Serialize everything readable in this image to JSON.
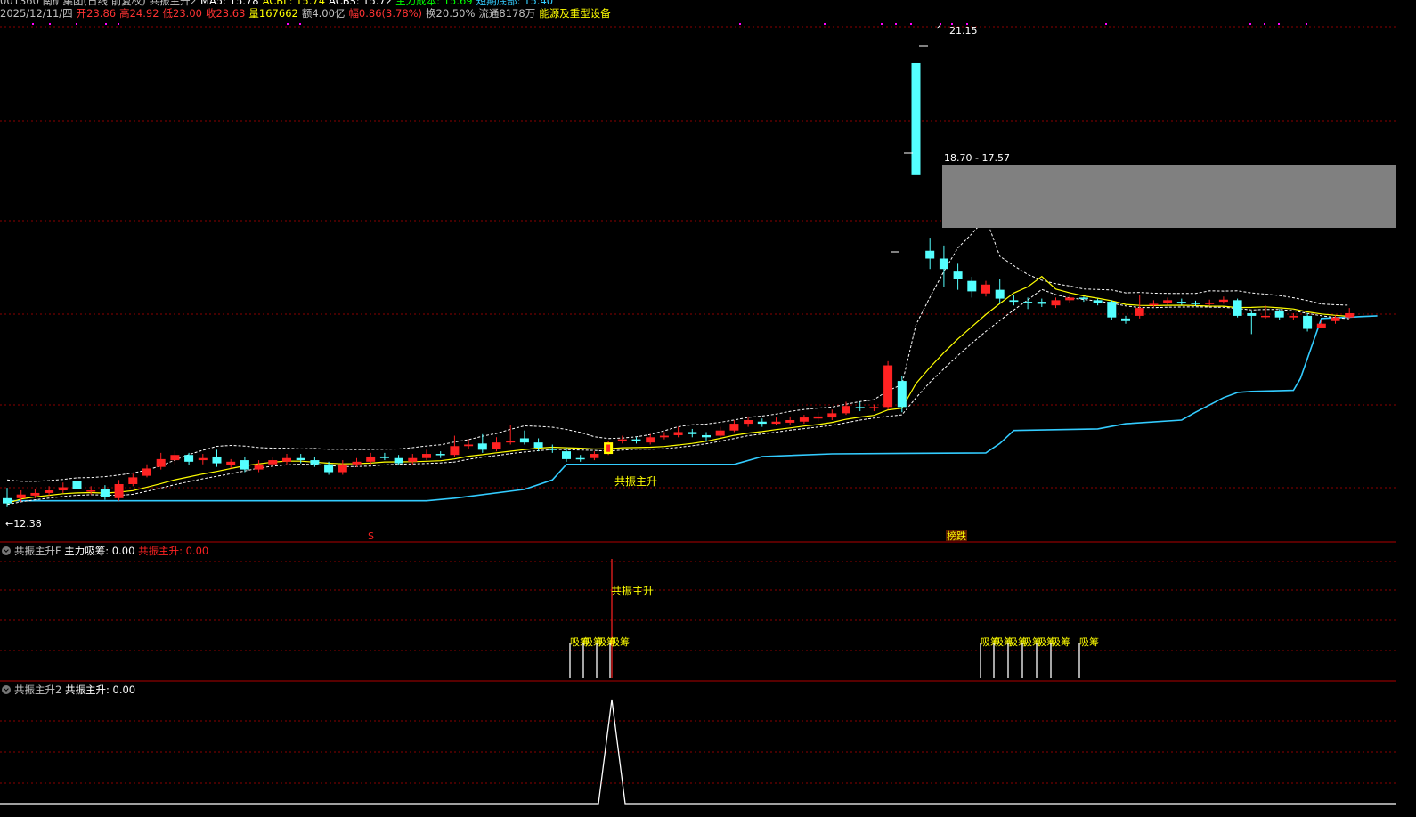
{
  "header": {
    "row1": [
      {
        "text": "001360 南矿集团(日线 前复权)",
        "color": "#c0c0c0"
      },
      {
        "text": "共振主升2",
        "color": "#c0c0c0"
      },
      {
        "text": "MA5: 15.78",
        "color": "#ffffff"
      },
      {
        "text": "ACBL: 15.74",
        "color": "#ffff00"
      },
      {
        "text": "ACBS: 15.72",
        "color": "#ffffff"
      },
      {
        "text": "主力成本: 15.69",
        "color": "#00ff00"
      },
      {
        "text": "短期底部: 15.40",
        "color": "#33ccff"
      }
    ],
    "row2": [
      {
        "text": "2025/12/11/四",
        "color": "#c0c0c0"
      },
      {
        "text": "开23.86",
        "color": "#ff3333"
      },
      {
        "text": "高24.92",
        "color": "#ff3333"
      },
      {
        "text": "低23.00",
        "color": "#ff3333"
      },
      {
        "text": "收23.63",
        "color": "#ff3333"
      },
      {
        "text": "量167662",
        "color": "#ffff00"
      },
      {
        "text": "额4.00亿",
        "color": "#c0c0c0"
      },
      {
        "text": "幅0.86(3.78%)",
        "color": "#ff3333"
      },
      {
        "text": "换20.50%",
        "color": "#c0c0c0"
      },
      {
        "text": "流通8178万",
        "color": "#c0c0c0"
      },
      {
        "text": "能源及重型设备",
        "color": "#ffff00"
      }
    ]
  },
  "main_panel": {
    "high_label": "21.15",
    "low_label": "12.38",
    "range_box_label": "18.70 - 17.57",
    "signal_label": "共振主升",
    "marker_s": "S",
    "marker_bang": "榜跌"
  },
  "panel2": {
    "name": "共振主升F",
    "value1": "主力吸筹: 0.00",
    "value2": "共振主升: 0.00",
    "signal_label": "共振主升",
    "absorb_label": "吸筹"
  },
  "panel3": {
    "name": "共振主升2",
    "value1": "共振主升: 0.00"
  },
  "colors": {
    "up": "#ff2222",
    "down": "#54ffff",
    "ma_yellow": "#ffff00",
    "ma_white": "#ffffff",
    "support": "#33ccff",
    "grid": "#8b0000",
    "magenta": "#ff00ff"
  },
  "chart_data": {
    "type": "candlestick",
    "ylim": [
      12.0,
      21.6
    ],
    "candles": [
      [
        12.55,
        12.45,
        12.75,
        12.38
      ],
      [
        12.55,
        12.62,
        12.7,
        12.48
      ],
      [
        12.6,
        12.65,
        12.72,
        12.55
      ],
      [
        12.65,
        12.7,
        12.78,
        12.6
      ],
      [
        12.7,
        12.76,
        12.85,
        12.65
      ],
      [
        12.88,
        12.72,
        12.95,
        12.68
      ],
      [
        12.68,
        12.7,
        12.78,
        12.62
      ],
      [
        12.72,
        12.58,
        12.8,
        12.52
      ],
      [
        12.55,
        12.82,
        12.9,
        12.5
      ],
      [
        12.82,
        12.95,
        13.02,
        12.78
      ],
      [
        12.98,
        13.12,
        13.2,
        12.95
      ],
      [
        13.15,
        13.3,
        13.42,
        13.1
      ],
      [
        13.28,
        13.38,
        13.46,
        13.2
      ],
      [
        13.38,
        13.25,
        13.42,
        13.18
      ],
      [
        13.28,
        13.32,
        13.4,
        13.2
      ],
      [
        13.35,
        13.22,
        13.48,
        13.15
      ],
      [
        13.18,
        13.25,
        13.3,
        13.12
      ],
      [
        13.28,
        13.1,
        13.35,
        13.05
      ],
      [
        13.1,
        13.2,
        13.28,
        13.05
      ],
      [
        13.2,
        13.28,
        13.35,
        13.15
      ],
      [
        13.25,
        13.32,
        13.4,
        13.2
      ],
      [
        13.32,
        13.28,
        13.4,
        13.22
      ],
      [
        13.28,
        13.2,
        13.35,
        13.15
      ],
      [
        13.2,
        13.05,
        13.25,
        13.0
      ],
      [
        13.05,
        13.2,
        13.28,
        13.0
      ],
      [
        13.2,
        13.25,
        13.32,
        13.15
      ],
      [
        13.25,
        13.35,
        13.42,
        13.2
      ],
      [
        13.35,
        13.32,
        13.42,
        13.28
      ],
      [
        13.32,
        13.22,
        13.38,
        13.18
      ],
      [
        13.25,
        13.32,
        13.4,
        13.2
      ],
      [
        13.32,
        13.4,
        13.48,
        13.28
      ],
      [
        13.4,
        13.38,
        13.45,
        13.32
      ],
      [
        13.38,
        13.55,
        13.75,
        13.35
      ],
      [
        13.55,
        13.58,
        13.68,
        13.5
      ],
      [
        13.6,
        13.48,
        13.78,
        13.42
      ],
      [
        13.5,
        13.62,
        13.72,
        13.45
      ],
      [
        13.62,
        13.65,
        13.95,
        13.58
      ],
      [
        13.7,
        13.62,
        13.85,
        13.58
      ],
      [
        13.62,
        13.52,
        13.7,
        13.45
      ],
      [
        13.5,
        13.48,
        13.58,
        13.42
      ],
      [
        13.45,
        13.3,
        13.52,
        13.25
      ],
      [
        13.32,
        13.3,
        13.38,
        13.25
      ],
      [
        13.32,
        13.4,
        13.45,
        13.28
      ],
      [
        13.4,
        13.62,
        13.65,
        13.38
      ],
      [
        13.65,
        13.68,
        13.75,
        13.6
      ],
      [
        13.68,
        13.65,
        13.72,
        13.6
      ],
      [
        13.62,
        13.72,
        13.78,
        13.58
      ],
      [
        13.72,
        13.75,
        13.82,
        13.68
      ],
      [
        13.76,
        13.82,
        13.92,
        13.72
      ],
      [
        13.82,
        13.78,
        13.88,
        13.72
      ],
      [
        13.76,
        13.72,
        13.82,
        13.65
      ],
      [
        13.75,
        13.85,
        13.92,
        13.72
      ],
      [
        13.85,
        13.98,
        14.05,
        13.82
      ],
      [
        13.98,
        14.05,
        14.12,
        13.92
      ],
      [
        14.02,
        13.98,
        14.08,
        13.92
      ],
      [
        13.98,
        14.02,
        14.1,
        13.95
      ],
      [
        14.0,
        14.05,
        14.12,
        13.96
      ],
      [
        14.02,
        14.1,
        14.15,
        13.98
      ],
      [
        14.08,
        14.12,
        14.2,
        14.02
      ],
      [
        14.1,
        14.18,
        14.25,
        14.05
      ],
      [
        14.18,
        14.32,
        14.4,
        14.15
      ],
      [
        14.3,
        14.28,
        14.4,
        14.22
      ],
      [
        14.28,
        14.3,
        14.35,
        14.22
      ],
      [
        14.3,
        15.1,
        15.18,
        14.25
      ],
      [
        14.8,
        14.3,
        14.9,
        14.2
      ],
      [
        20.9,
        18.75,
        21.15,
        17.2
      ],
      [
        17.3,
        17.15,
        17.55,
        16.95
      ],
      [
        17.15,
        16.95,
        17.4,
        16.6
      ],
      [
        16.9,
        16.75,
        17.05,
        16.55
      ],
      [
        16.72,
        16.52,
        16.8,
        16.4
      ],
      [
        16.48,
        16.65,
        16.72,
        16.42
      ],
      [
        16.55,
        16.38,
        16.75,
        16.3
      ],
      [
        16.35,
        16.32,
        16.45,
        16.25
      ],
      [
        16.32,
        16.3,
        16.4,
        16.18
      ],
      [
        16.32,
        16.28,
        16.38,
        16.22
      ],
      [
        16.25,
        16.35,
        16.4,
        16.2
      ],
      [
        16.35,
        16.4,
        16.45,
        16.3
      ],
      [
        16.4,
        16.38,
        16.42,
        16.32
      ],
      [
        16.35,
        16.3,
        16.38,
        16.25
      ],
      [
        16.32,
        16.02,
        16.35,
        15.98
      ],
      [
        16.0,
        15.95,
        16.05,
        15.9
      ],
      [
        16.05,
        16.2,
        16.45,
        16.0
      ],
      [
        16.25,
        16.28,
        16.35,
        16.22
      ],
      [
        16.3,
        16.35,
        16.4,
        16.26
      ],
      [
        16.32,
        16.3,
        16.38,
        16.26
      ],
      [
        16.3,
        16.28,
        16.34,
        16.24
      ],
      [
        16.28,
        16.3,
        16.36,
        16.25
      ],
      [
        16.32,
        16.36,
        16.42,
        16.28
      ],
      [
        16.35,
        16.05,
        16.38,
        16.02
      ],
      [
        16.1,
        16.05,
        16.15,
        15.7
      ],
      [
        16.05,
        16.05,
        16.25,
        16.0
      ],
      [
        16.15,
        16.02,
        16.18,
        15.98
      ],
      [
        16.02,
        16.05,
        16.1,
        15.98
      ],
      [
        16.05,
        15.8,
        16.1,
        15.75
      ],
      [
        15.82,
        15.9,
        15.98,
        15.82
      ],
      [
        15.95,
        16.02,
        16.06,
        15.9
      ],
      [
        16.02,
        16.1,
        16.2,
        16.0
      ]
    ],
    "support_line": [
      [
        0,
        12.5
      ],
      [
        30,
        12.5
      ],
      [
        32,
        12.55
      ],
      [
        37,
        12.72
      ],
      [
        39,
        12.9
      ],
      [
        40,
        13.2
      ],
      [
        52,
        13.2
      ],
      [
        54,
        13.35
      ],
      [
        59,
        13.4
      ],
      [
        70,
        13.42
      ],
      [
        71,
        13.6
      ],
      [
        72,
        13.85
      ],
      [
        78,
        13.88
      ],
      [
        80,
        13.98
      ],
      [
        84,
        14.05
      ],
      [
        85,
        14.2
      ],
      [
        87,
        14.48
      ],
      [
        88,
        14.58
      ],
      [
        89,
        14.6
      ],
      [
        92,
        14.62
      ],
      [
        92.5,
        14.85
      ],
      [
        94,
        16.0
      ],
      [
        98,
        16.05
      ]
    ]
  }
}
